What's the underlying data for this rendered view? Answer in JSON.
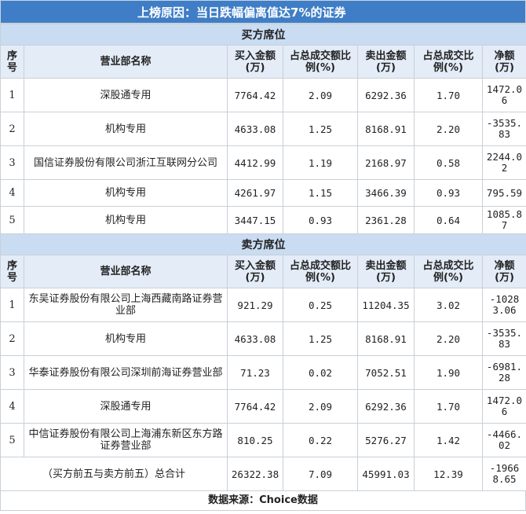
{
  "title": "上榜原因：当日跌幅偏离值达7%的证券",
  "headers": {
    "idx": "序号",
    "name": "营业部名称",
    "buy": "买入金额(万)",
    "buy_ratio": "占总成交额比例(%)",
    "sell": "卖出金额(万)",
    "sell_ratio": "占总成交比例(%)",
    "net": "净额(万)"
  },
  "buy_section": {
    "label": "买方席位",
    "rows": [
      {
        "idx": "1",
        "name": "深股通专用",
        "buy": "7764.42",
        "buy_ratio": "2.09",
        "sell": "6292.36",
        "sell_ratio": "1.70",
        "net": "1472.06"
      },
      {
        "idx": "2",
        "name": "机构专用",
        "buy": "4633.08",
        "buy_ratio": "1.25",
        "sell": "8168.91",
        "sell_ratio": "2.20",
        "net": "-3535.83"
      },
      {
        "idx": "3",
        "name": "国信证券股份有限公司浙江互联网分公司",
        "buy": "4412.99",
        "buy_ratio": "1.19",
        "sell": "2168.97",
        "sell_ratio": "0.58",
        "net": "2244.02"
      },
      {
        "idx": "4",
        "name": "机构专用",
        "buy": "4261.97",
        "buy_ratio": "1.15",
        "sell": "3466.39",
        "sell_ratio": "0.93",
        "net": "795.59"
      },
      {
        "idx": "5",
        "name": "机构专用",
        "buy": "3447.15",
        "buy_ratio": "0.93",
        "sell": "2361.28",
        "sell_ratio": "0.64",
        "net": "1085.87"
      }
    ]
  },
  "sell_section": {
    "label": "卖方席位",
    "rows": [
      {
        "idx": "1",
        "name": "东吴证券股份有限公司上海西藏南路证券营业部",
        "buy": "921.29",
        "buy_ratio": "0.25",
        "sell": "11204.35",
        "sell_ratio": "3.02",
        "net": "-10283.06"
      },
      {
        "idx": "2",
        "name": "机构专用",
        "buy": "4633.08",
        "buy_ratio": "1.25",
        "sell": "8168.91",
        "sell_ratio": "2.20",
        "net": "-3535.83"
      },
      {
        "idx": "3",
        "name": "华泰证券股份有限公司深圳前海证券营业部",
        "buy": "71.23",
        "buy_ratio": "0.02",
        "sell": "7052.51",
        "sell_ratio": "1.90",
        "net": "-6981.28"
      },
      {
        "idx": "4",
        "name": "深股通专用",
        "buy": "7764.42",
        "buy_ratio": "2.09",
        "sell": "6292.36",
        "sell_ratio": "1.70",
        "net": "1472.06"
      },
      {
        "idx": "5",
        "name": "中信证券股份有限公司上海浦东新区东方路证券营业部",
        "buy": "810.25",
        "buy_ratio": "0.22",
        "sell": "5276.27",
        "sell_ratio": "1.42",
        "net": "-4466.02"
      }
    ]
  },
  "total": {
    "label": "（买方前五与卖方前五）总合计",
    "buy": "26322.38",
    "buy_ratio": "7.09",
    "sell": "45991.03",
    "sell_ratio": "12.39",
    "net": "-19668.65"
  },
  "footer": "数据来源：Choice数据"
}
